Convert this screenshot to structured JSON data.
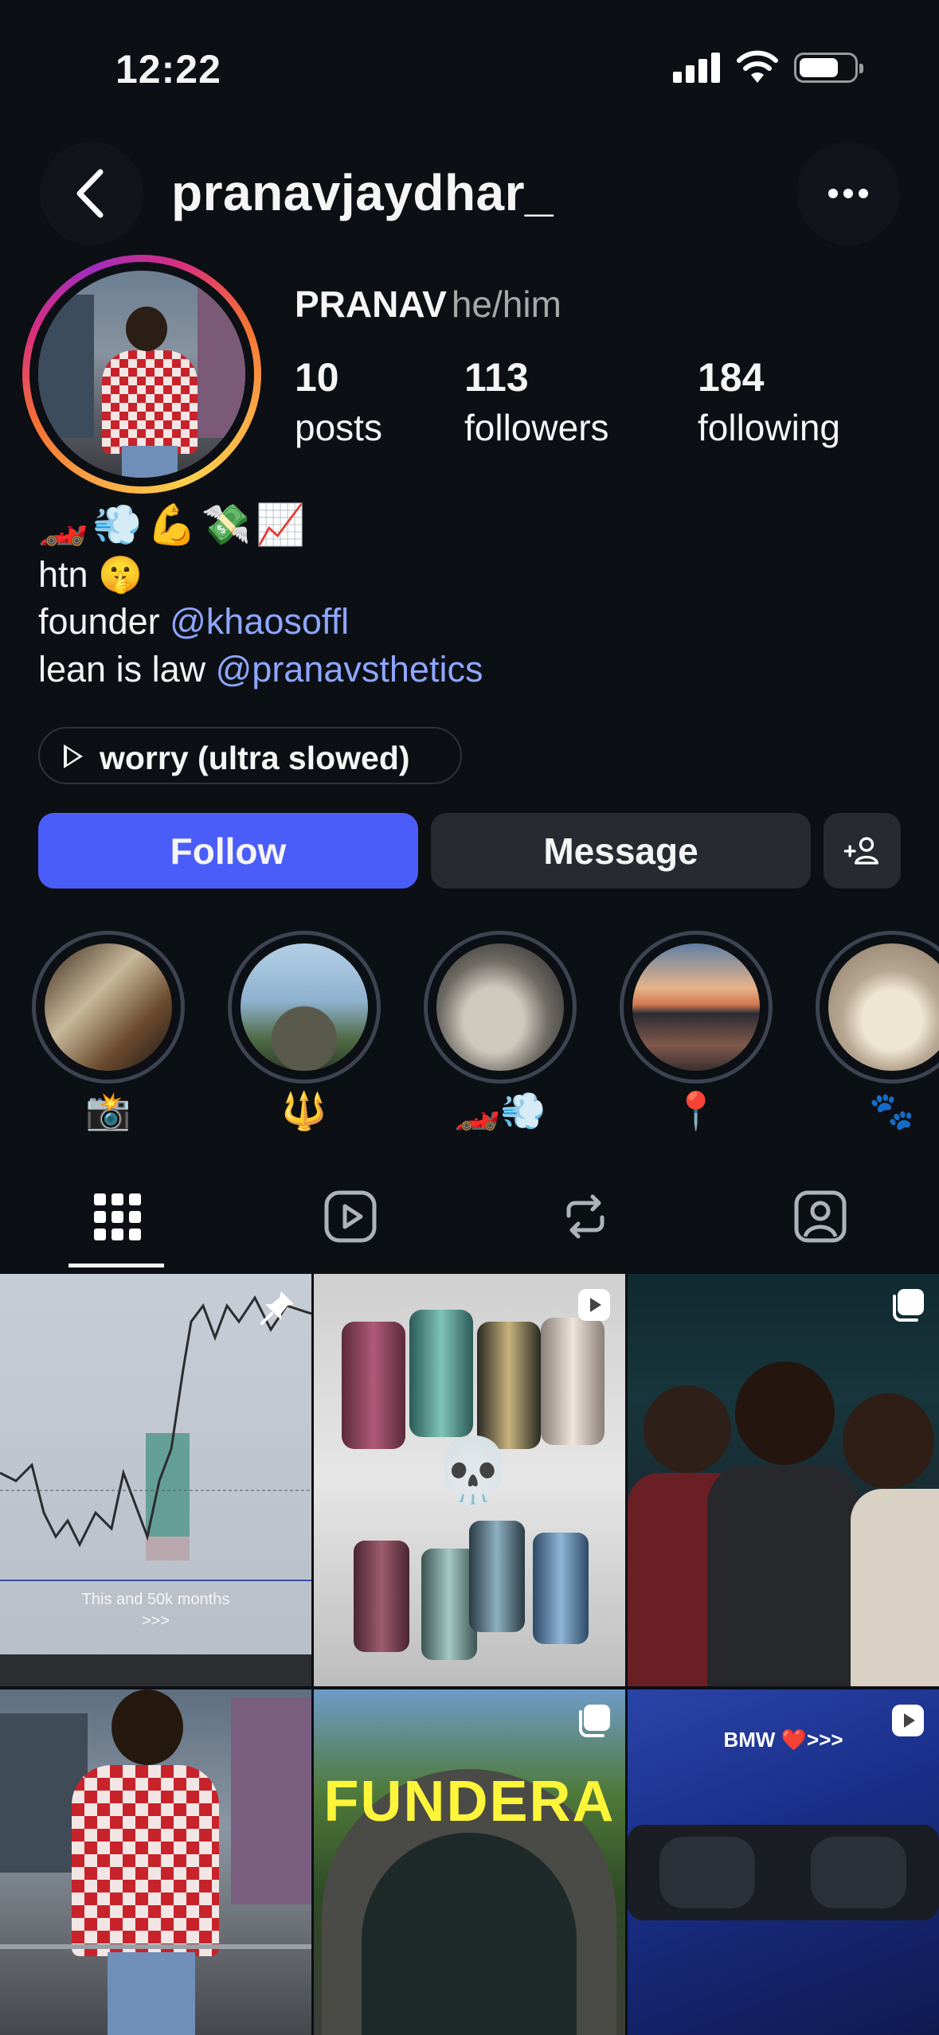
{
  "status_bar": {
    "time": "12:22"
  },
  "header": {
    "username": "pranavjaydhar_"
  },
  "profile": {
    "name": "PRANAV",
    "pronouns": "he/him",
    "stats": [
      {
        "value": "10",
        "label": "posts"
      },
      {
        "value": "113",
        "label": "followers"
      },
      {
        "value": "184",
        "label": "following"
      }
    ],
    "bio": {
      "emoji_line": "🏎️💨💪💸📈",
      "line2": "htn 🤫",
      "line3_text": "founder ",
      "line3_mention": "@khaosoffl",
      "line4_text": "lean is law ",
      "line4_mention": "@pranavsthetics"
    },
    "music": "worry (ultra slowed)"
  },
  "actions": {
    "follow": "Follow",
    "message": "Message"
  },
  "highlights": [
    {
      "label": "📸"
    },
    {
      "label": "🔱"
    },
    {
      "label": "🏎️💨"
    },
    {
      "label": "📍"
    },
    {
      "label": "🐾"
    }
  ],
  "tabs": [
    "grid-icon",
    "reels-icon",
    "reposts-icon",
    "tagged-icon"
  ],
  "grid": {
    "post1_caption_line1": "This and 50k months",
    "post1_caption_line2": ">>>",
    "post2_emoji": "💀",
    "post5_sign": "FUNDERA",
    "post6_text": "BMW ❤️>>>"
  },
  "colors": {
    "background": "#0c0f14",
    "follow_button": "#4a5df9",
    "mention": "#8ea6ff",
    "secondary_button": "#272b31"
  }
}
